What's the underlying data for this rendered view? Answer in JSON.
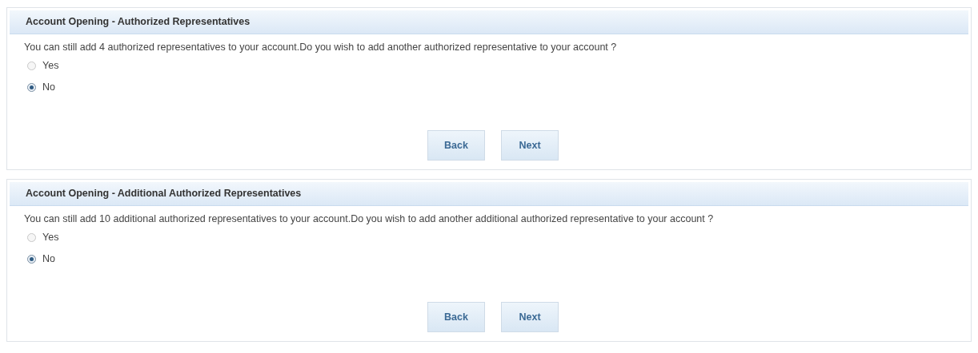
{
  "panels": [
    {
      "title": "Account Opening - Authorized Representatives",
      "question": "You can still add 4 authorized representatives to your account.Do you wish to add another authorized representative to your account ?",
      "options": [
        {
          "label": "Yes",
          "selected": false
        },
        {
          "label": "No",
          "selected": true
        }
      ],
      "buttons": [
        "Back",
        "Next"
      ]
    },
    {
      "title": "Account Opening - Additional Authorized Representatives",
      "question": "You can still add 10 additional authorized representatives to your account.Do you wish to add another additional authorized representative to your account ?",
      "options": [
        {
          "label": "Yes",
          "selected": false
        },
        {
          "label": "No",
          "selected": true
        }
      ],
      "buttons": [
        "Back",
        "Next"
      ]
    }
  ]
}
